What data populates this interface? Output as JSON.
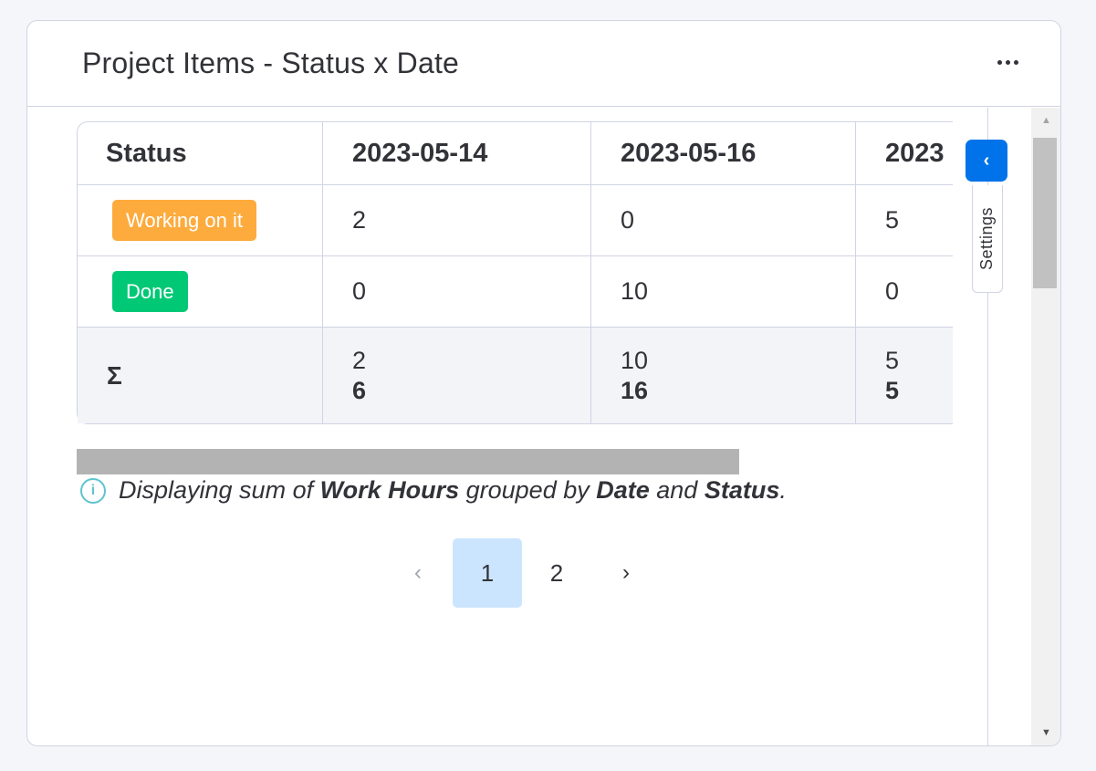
{
  "widget": {
    "title": "Project Items - Status x Date",
    "menu_icon": "more-dots-icon"
  },
  "table": {
    "columns": [
      "Status",
      "2023-05-14",
      "2023-05-16",
      "2023"
    ],
    "rows": [
      {
        "status": "Working on it",
        "status_color": "#fdab3d",
        "values": [
          "2",
          "0",
          "5"
        ]
      },
      {
        "status": "Done",
        "status_color": "#00c875",
        "values": [
          "0",
          "10",
          "0"
        ]
      }
    ],
    "sum_row": {
      "label": "Σ",
      "values": [
        "2",
        "10",
        "5"
      ],
      "totals": [
        "6",
        "16",
        "5"
      ]
    }
  },
  "info": {
    "icon": "info-icon",
    "prefix": "Displaying sum of ",
    "measure": "Work Hours",
    "middle": " grouped by ",
    "group1": "Date",
    "and": " and ",
    "group2": "Status",
    "suffix": "."
  },
  "pagination": {
    "prev": "‹",
    "pages": [
      "1",
      "2"
    ],
    "current": "1",
    "next": "›"
  },
  "settings": {
    "label": "Settings",
    "collapse_icon": "‹"
  },
  "scroll": {
    "up": "▲",
    "down": "▼"
  }
}
